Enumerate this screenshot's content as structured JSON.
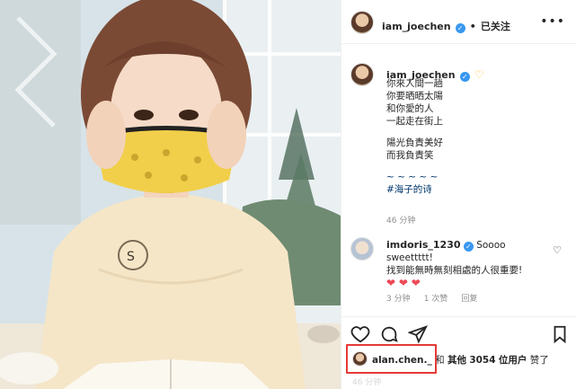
{
  "header": {
    "username": "iam_joechen",
    "separator": "•",
    "follow_label": "已关注",
    "more_icon": "more-horizontal-icon"
  },
  "caption": {
    "username": "iam_joechen",
    "lines": [
      "你來人間一趟",
      "你要晒晒太陽",
      "和你愛的人",
      "一起走在街上",
      "",
      "陽光負責美好",
      "而我負責笑",
      "",
      "~ ~ ~ ~ ~"
    ],
    "hashtag": "#海子的诗",
    "time": "46 分钟"
  },
  "comment": {
    "username": "imdoris_1230",
    "text": "Soooo sweettttt!",
    "text2": "找到能無時無刻相處的人很重要!",
    "hearts": "❤️❤️❤️",
    "time": "3 分钟",
    "likes": "1 次赞",
    "reply": "回复"
  },
  "actions": {
    "like_icon": "heart-icon",
    "comment_icon": "comment-icon",
    "share_icon": "send-icon",
    "save_icon": "bookmark-icon"
  },
  "likes_line": {
    "user": "alan.chen._",
    "and": "和",
    "others": "其他",
    "count": "3054",
    "users_label": "位用户",
    "liked": "赞了"
  },
  "footer": {
    "time_partial": "46 分钟"
  },
  "colors": {
    "verified": "#3897f0",
    "heart_red": "#ed4956",
    "highlight_box": "#e53935",
    "mask_yellow": "#f2cf4a",
    "sweater": "#f5e6c8"
  }
}
